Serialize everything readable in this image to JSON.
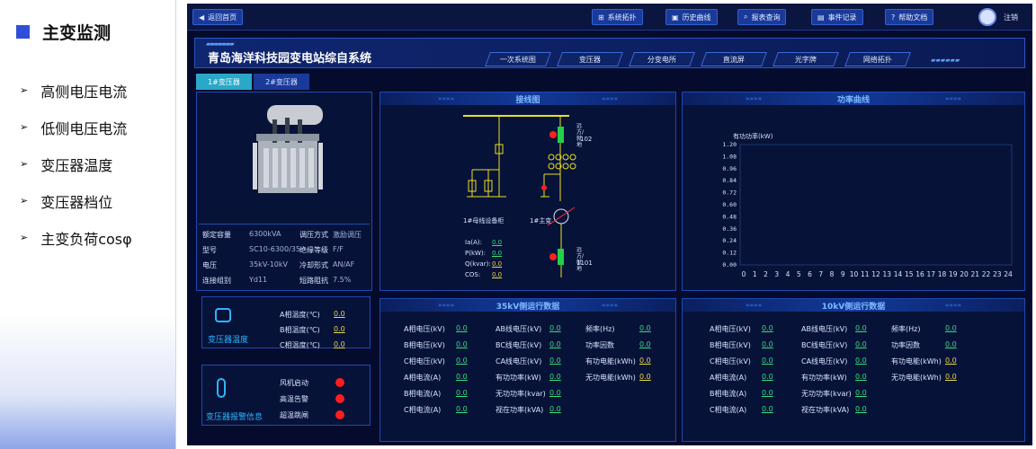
{
  "left": {
    "title": "主变监测",
    "items": [
      "高侧电压电流",
      "低侧电压电流",
      "变压器温度",
      "变压器档位",
      "主变负荷cosφ"
    ]
  },
  "topbar": {
    "back": "返回首页",
    "buttons": [
      "系统拓扑",
      "历史曲线",
      "报表查询",
      "事件记录",
      "帮助文档"
    ],
    "logout": "注销"
  },
  "title": {
    "system": "青岛海洋科技园变电站综自系统",
    "nav": [
      "一次系统图",
      "变压器",
      "分变电所",
      "直流屏",
      "光字牌",
      "网络拓扑"
    ]
  },
  "tabs": [
    "1#变压器",
    "2#变压器"
  ],
  "transformer": {
    "rows": [
      [
        "额定容量",
        "6300kVA",
        "调压方式",
        "激励调压"
      ],
      [
        "型号",
        "SC10-6300/35",
        "绝缘等级",
        "F/F"
      ],
      [
        "电压",
        "35kV-10kV",
        "冷却形式",
        "AN/AF"
      ],
      [
        "连接组别",
        "Yd11",
        "短路阻抗",
        "7.5%"
      ]
    ],
    "temp_label": "变压器温度",
    "temps": [
      [
        "A相温度(℃)",
        "0.0"
      ],
      [
        "B相温度(℃)",
        "0.0"
      ],
      [
        "C相温度(℃)",
        "0.0"
      ]
    ],
    "alarm_label": "变压器报警信息",
    "alarms": [
      "风机启动",
      "高温告警",
      "超温跳闸"
    ]
  },
  "wiring": {
    "title": "接线图",
    "bus_label": "1#母线设备柜",
    "xf_label": "1#主变",
    "sw1": "102",
    "sw2": "1101",
    "vert1": "远方/就地",
    "vert2": "远方/就地",
    "meas": [
      [
        "Ia(A):",
        "0.0"
      ],
      [
        "P(kW):",
        "0.0"
      ],
      [
        "Q(kvar):",
        "0.0"
      ],
      [
        "COS:",
        "0.0"
      ]
    ]
  },
  "power": {
    "title": "功率曲线",
    "ylabel": "有功功率(kW)"
  },
  "chart_data": {
    "type": "line",
    "title": "功率曲线",
    "ylabel": "有功功率(kW)",
    "xlabel": "",
    "x": [
      0,
      1,
      2,
      3,
      4,
      5,
      6,
      7,
      8,
      9,
      10,
      11,
      12,
      13,
      14,
      15,
      16,
      17,
      18,
      19,
      20,
      21,
      22,
      23,
      24
    ],
    "yticks": [
      "0.00",
      "0.12",
      "0.24",
      "0.36",
      "0.48",
      "0.60",
      "0.72",
      "0.84",
      "0.96",
      "1.08",
      "1.20"
    ],
    "ylim": [
      0,
      1.2
    ],
    "series": []
  },
  "hv": {
    "title": "35kV侧运行数据",
    "c1": [
      [
        "A相电压(kV)",
        "0.0"
      ],
      [
        "B相电压(kV)",
        "0.0"
      ],
      [
        "C相电压(kV)",
        "0.0"
      ],
      [
        "A相电流(A)",
        "0.0"
      ],
      [
        "B相电流(A)",
        "0.0"
      ],
      [
        "C相电流(A)",
        "0.0"
      ]
    ],
    "c2": [
      [
        "AB线电压(kV)",
        "0.0"
      ],
      [
        "BC线电压(kV)",
        "0.0"
      ],
      [
        "CA线电压(kV)",
        "0.0"
      ],
      [
        "有功功率(kW)",
        "0.0"
      ],
      [
        "无功功率(kvar)",
        "0.0"
      ],
      [
        "视在功率(kVA)",
        "0.0"
      ]
    ],
    "c3": [
      [
        "频率(Hz)",
        "0.0"
      ],
      [
        "功率因数",
        "0.0"
      ],
      [
        "有功电能(kWh)",
        "0.0"
      ],
      [
        "无功电能(kWh)",
        "0.0"
      ]
    ]
  },
  "lv": {
    "title": "10kV侧运行数据",
    "c1": [
      [
        "A相电压(kV)",
        "0.0"
      ],
      [
        "B相电压(kV)",
        "0.0"
      ],
      [
        "C相电压(kV)",
        "0.0"
      ],
      [
        "A相电流(A)",
        "0.0"
      ],
      [
        "B相电流(A)",
        "0.0"
      ],
      [
        "C相电流(A)",
        "0.0"
      ]
    ],
    "c2": [
      [
        "AB线电压(kV)",
        "0.0"
      ],
      [
        "BC线电压(kV)",
        "0.0"
      ],
      [
        "CA线电压(kV)",
        "0.0"
      ],
      [
        "有功功率(kW)",
        "0.0"
      ],
      [
        "无功功率(kvar)",
        "0.0"
      ],
      [
        "视在功率(kVA)",
        "0.0"
      ]
    ],
    "c3": [
      [
        "频率(Hz)",
        "0.0"
      ],
      [
        "功率因数",
        "0.0"
      ],
      [
        "有功电能(kWh)",
        "0.0"
      ],
      [
        "无功电能(kWh)",
        "0.0"
      ]
    ]
  }
}
